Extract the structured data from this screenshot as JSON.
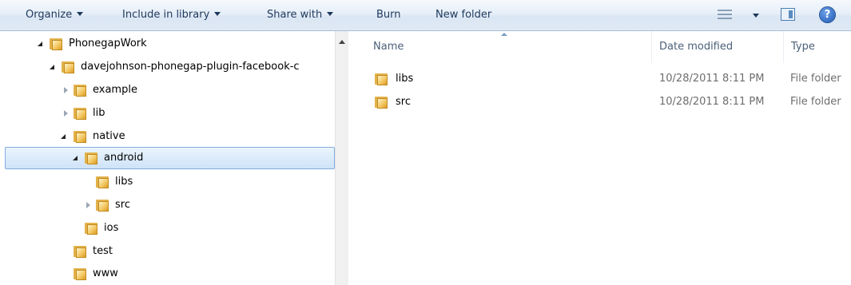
{
  "toolbar": {
    "organize": "Organize",
    "include_in_library": "Include in library",
    "share_with": "Share with",
    "burn": "Burn",
    "new_folder": "New folder",
    "help_glyph": "?"
  },
  "tree": {
    "items": [
      {
        "label": "PhonegapWork",
        "expander": "open"
      },
      {
        "label": "davejohnson-phonegap-plugin-facebook-c",
        "expander": "open"
      },
      {
        "label": "example",
        "expander": "closed"
      },
      {
        "label": "lib",
        "expander": "closed"
      },
      {
        "label": "native",
        "expander": "open"
      },
      {
        "label": "android",
        "expander": "open",
        "selected": true
      },
      {
        "label": "libs",
        "expander": "none"
      },
      {
        "label": "src",
        "expander": "closed"
      },
      {
        "label": "ios",
        "expander": "none"
      },
      {
        "label": "test",
        "expander": "none"
      },
      {
        "label": "www",
        "expander": "none"
      }
    ]
  },
  "columns": {
    "name": "Name",
    "date_modified": "Date modified",
    "type": "Type"
  },
  "files": [
    {
      "name": "libs",
      "date": "10/28/2011 8:11 PM",
      "type": "File folder"
    },
    {
      "name": "src",
      "date": "10/28/2011 8:11 PM",
      "type": "File folder"
    }
  ],
  "colors": {
    "accent": "#84acdd",
    "folder": "#f2c45c",
    "toolbar_text": "#1e395b"
  },
  "icons": [
    "caret-down-icon",
    "views-icon",
    "preview-pane-icon",
    "help-icon",
    "folder-icon",
    "expand-arrow-icon",
    "collapse-arrow-icon"
  ]
}
